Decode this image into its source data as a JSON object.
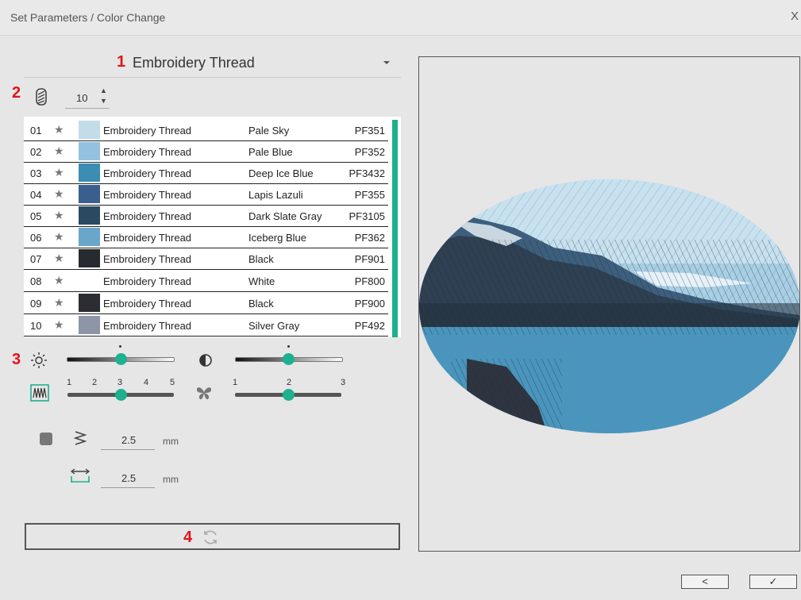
{
  "window": {
    "title": "Set Parameters / Color Change",
    "close_label": "X"
  },
  "annotations": {
    "a1": "1",
    "a2": "2",
    "a3": "3",
    "a4": "4"
  },
  "thread_type": {
    "selected": "Embroidery Thread"
  },
  "thread_count": {
    "value": "10"
  },
  "threads": [
    {
      "num": "01",
      "brand": "Embroidery Thread",
      "name": "Pale Sky",
      "code": "PF351",
      "color": "#c2dde8"
    },
    {
      "num": "02",
      "brand": "Embroidery Thread",
      "name": "Pale Blue",
      "code": "PF352",
      "color": "#94c1df"
    },
    {
      "num": "03",
      "brand": "Embroidery Thread",
      "name": "Deep Ice Blue",
      "code": "PF3432",
      "color": "#3b8db3"
    },
    {
      "num": "04",
      "brand": "Embroidery Thread",
      "name": "Lapis Lazuli",
      "code": "PF355",
      "color": "#3a5f8e"
    },
    {
      "num": "05",
      "brand": "Embroidery Thread",
      "name": "Dark Slate Gray",
      "code": "PF3105",
      "color": "#2b4a62"
    },
    {
      "num": "06",
      "brand": "Embroidery Thread",
      "name": "Iceberg Blue",
      "code": "PF362",
      "color": "#6aa5cb"
    },
    {
      "num": "07",
      "brand": "Embroidery Thread",
      "name": "Black",
      "code": "PF901",
      "color": "#272a2e"
    },
    {
      "num": "08",
      "brand": "Embroidery Thread",
      "name": "White",
      "code": "PF800",
      "color": "#ffffff"
    },
    {
      "num": "09",
      "brand": "Embroidery Thread",
      "name": "Black",
      "code": "PF900",
      "color": "#2b2d33"
    },
    {
      "num": "10",
      "brand": "Embroidery Thread",
      "name": "Silver Gray",
      "code": "PF492",
      "color": "#8d95a6"
    }
  ],
  "sliders": {
    "brightness": {
      "icon": "brightness-icon",
      "value_fraction": 0.5
    },
    "contrast": {
      "icon": "contrast-icon",
      "value_fraction": 0.5
    },
    "stitch_density": {
      "icon": "stitch-pattern-icon",
      "ticks": [
        "1",
        "2",
        "3",
        "4",
        "5"
      ],
      "value": 3
    },
    "color_variation": {
      "icon": "butterfly-icon",
      "ticks": [
        "1",
        "2",
        "3"
      ],
      "value": 2
    }
  },
  "stitch_settings": {
    "zigzag_value": "2.5",
    "zigzag_unit": "mm",
    "width_value": "2.5",
    "width_unit": "mm"
  },
  "buttons": {
    "back_label": "<",
    "ok_label": "✓"
  },
  "colors": {
    "accent": "#1fb08d",
    "annotation": "#e3121a"
  }
}
